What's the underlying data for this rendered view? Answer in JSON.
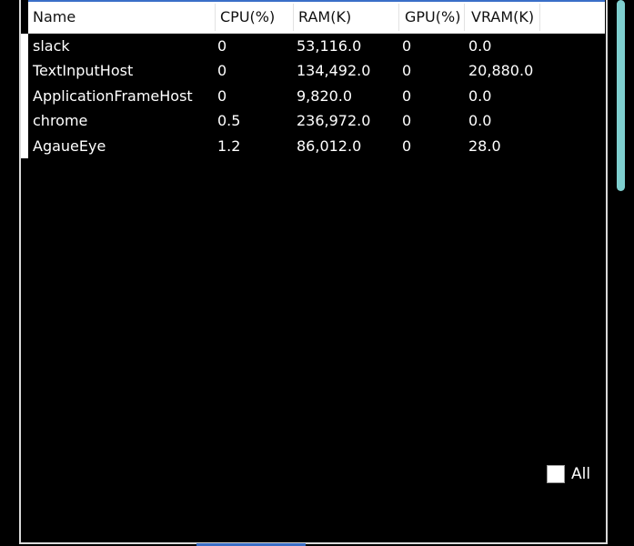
{
  "table": {
    "columns": [
      "Name",
      "CPU(%)",
      "RAM(K)",
      "GPU(%)",
      "VRAM(K)"
    ],
    "rows": [
      {
        "name": "slack",
        "cpu": "0",
        "ram": "53,116.0",
        "gpu": "0",
        "vram": "0.0"
      },
      {
        "name": "TextInputHost",
        "cpu": "0",
        "ram": "134,492.0",
        "gpu": "0",
        "vram": "20,880.0"
      },
      {
        "name": "ApplicationFrameHost",
        "cpu": "0",
        "ram": "9,820.0",
        "gpu": "0",
        "vram": "0.0"
      },
      {
        "name": "chrome",
        "cpu": "0.5",
        "ram": "236,972.0",
        "gpu": "0",
        "vram": "0.0"
      },
      {
        "name": "AgaueEye",
        "cpu": "1.2",
        "ram": "86,012.0",
        "gpu": "0",
        "vram": "28.0"
      }
    ]
  },
  "filter": {
    "all_label": "All",
    "all_checked": false
  },
  "colors": {
    "background": "#000000",
    "header_bg": "#ffffff",
    "accent": "#3a6fc8",
    "scrollbar": "#7fcfcf",
    "text": "#ffffff"
  }
}
